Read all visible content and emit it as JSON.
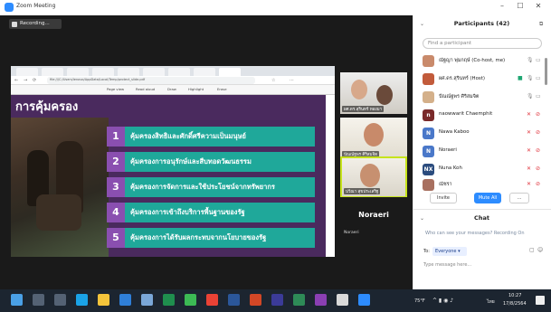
{
  "window": {
    "title": "Zoom Meeting",
    "minimize": "–",
    "maximize": "☐",
    "close": "✕"
  },
  "recording": {
    "label": "Recording..."
  },
  "slide": {
    "title": "การคุ้มครอง",
    "items": [
      {
        "number": "1",
        "text": "คุ้มครองสิทธิและศักดิ์ศรีความเป็นมนุษย์"
      },
      {
        "number": "2",
        "text": "คุ้มครองการอนุรักษ์และสืบทอดวัฒนธรรม"
      },
      {
        "number": "3",
        "text": "คุ้มครองการจัดการและใช้ประโยชน์จากทรัพยากร"
      },
      {
        "number": "4",
        "text": "คุ้มครองการเข้าถึงบริการพื้นฐานของรัฐ"
      },
      {
        "number": "5",
        "text": "คุ้มครองการได้รับผลกระทบจากนโยบายของรัฐ"
      }
    ]
  },
  "browser": {
    "url": "file:///C:/Users/lenovo/AppData/Local/Temp/protect_slide.pdf",
    "toolbar": [
      "Page view",
      "Read aloud",
      "Draw",
      "Highlight",
      "Erase"
    ]
  },
  "videos": [
    {
      "name": "ผศ.ดร.สุรินทร์ ทองมา"
    },
    {
      "name": "ปัณณ์ฐพร ศิริสมจิต"
    },
    {
      "name": "ปวีณา สุขประเสริฐ"
    }
  ],
  "noraeri": {
    "big": "Noraeri",
    "small": "Noraeri"
  },
  "participants": {
    "title": "Participants (42)",
    "search_placeholder": "Find a participant",
    "list": [
      {
        "initial": "",
        "name": "ณัฐญา พุ่มกฤษ์ (Co-host, me)",
        "color": "#c98a6b"
      },
      {
        "initial": "",
        "name": "ผศ.ดร.สุรินทร์ (Host)",
        "color": "#c25b3b"
      },
      {
        "initial": "",
        "name": "ปัณณ์ฐพร ศิริสมจิต",
        "color": "#d4b08a"
      },
      {
        "initial": "n",
        "name": "naowwarit Chaemphit",
        "color": "#7a2a2a"
      },
      {
        "initial": "N",
        "name": "Nawa Kaboo",
        "color": "#4a78c9"
      },
      {
        "initial": "N",
        "name": "Noraeri",
        "color": "#4a78c9"
      },
      {
        "initial": "NX",
        "name": "Nuna Koh",
        "color": "#2b4c7e"
      },
      {
        "initial": "",
        "name": "ณัชรา",
        "color": "#a87060"
      }
    ],
    "buttons": {
      "invite": "Invite",
      "mute_all": "Mute All",
      "more": "..."
    }
  },
  "chat": {
    "title": "Chat",
    "notice": "Who can see your messages? Recording On",
    "to_label": "To:",
    "to_value": "Everyone ▾",
    "placeholder": "Type message here..."
  },
  "taskbar": {
    "weather": "75°F",
    "language": "ไทย",
    "time": "10:27",
    "date": "17/8/2564"
  }
}
